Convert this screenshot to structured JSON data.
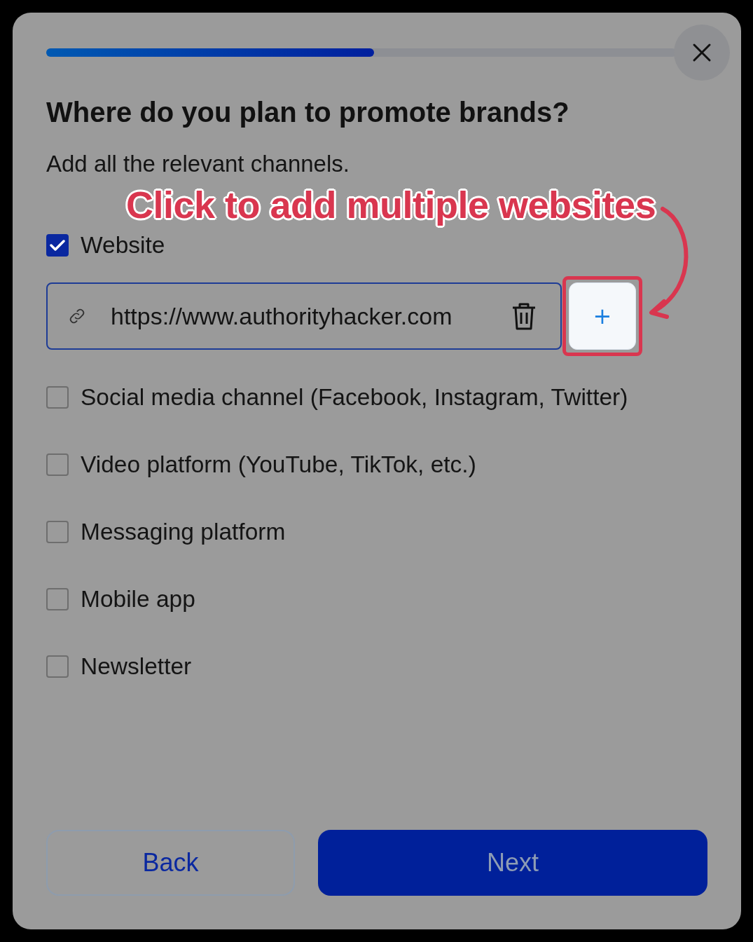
{
  "progress": {
    "level": 0.52
  },
  "title": "Where do you plan to promote brands?",
  "subtitle": "Add all the relevant channels.",
  "annotation": {
    "text": "Click to add multiple websites"
  },
  "channels": [
    {
      "label": "Website",
      "checked": true,
      "kind": "url",
      "url": "https://www.authorityhacker.com",
      "add_label": "+"
    },
    {
      "label": "Social media channel (Facebook, Instagram, Twitter)",
      "checked": false,
      "kind": "plain"
    },
    {
      "label": "Video platform (YouTube, TikTok, etc.)",
      "checked": false,
      "kind": "plain"
    },
    {
      "label": "Messaging platform",
      "checked": false,
      "kind": "plain"
    },
    {
      "label": "Mobile app",
      "checked": false,
      "kind": "plain"
    },
    {
      "label": "Newsletter",
      "checked": false,
      "kind": "plain"
    }
  ],
  "buttons": [
    {
      "label": "Back",
      "kind": "secondary"
    },
    {
      "label": "Next",
      "kind": "primary"
    }
  ]
}
